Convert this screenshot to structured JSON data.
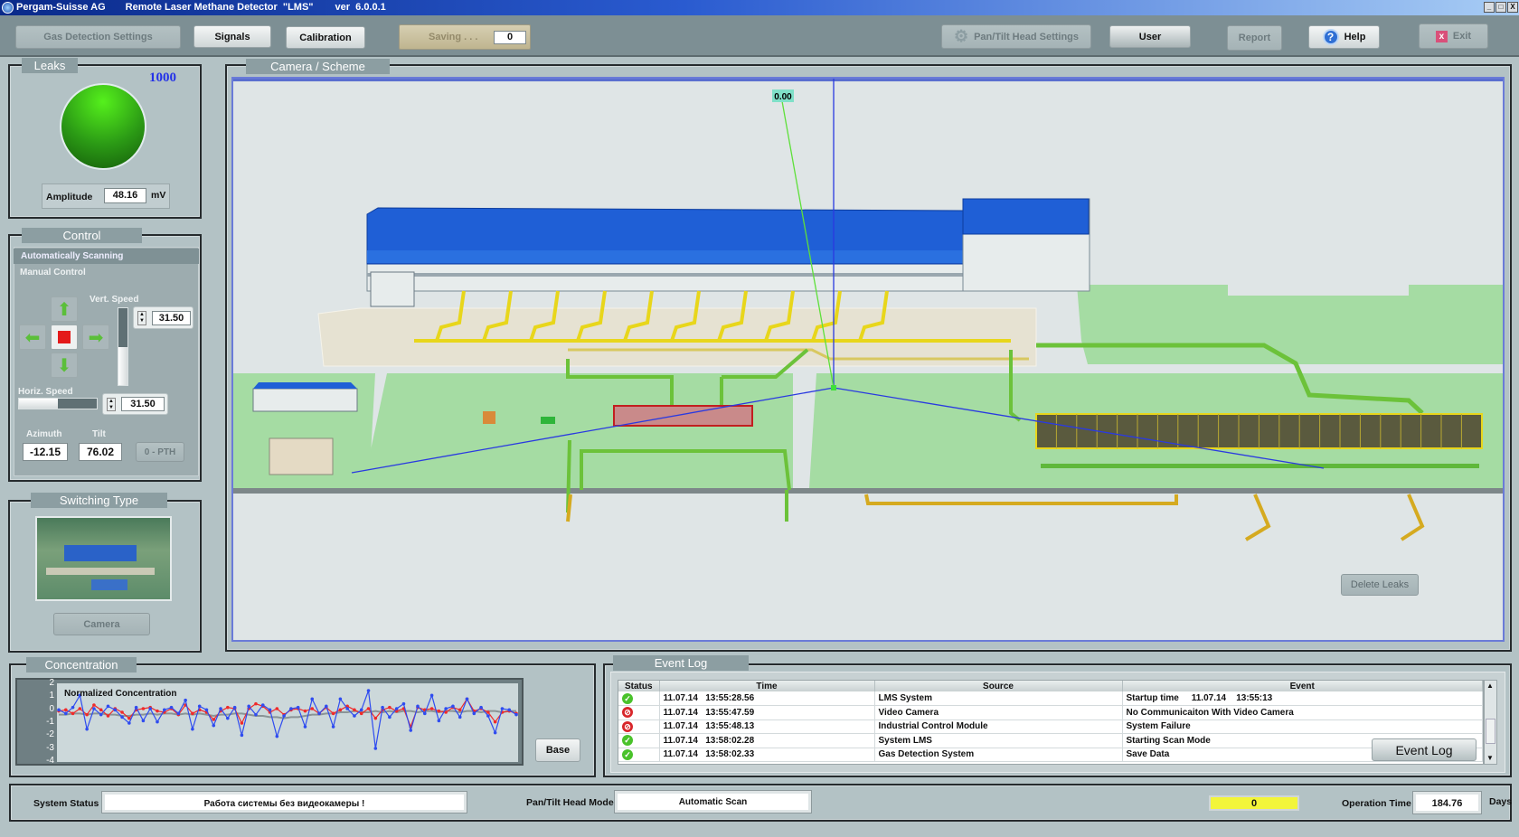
{
  "window": {
    "company": "Pergam-Suisse AG",
    "title": "Remote Laser Methane Detector  \"LMS\"",
    "version": "ver  6.0.0.1",
    "controls": [
      "_",
      "□",
      "X"
    ]
  },
  "toolbar": {
    "gas_detection_settings": "Gas Detection Settings",
    "signals": "Signals",
    "calibration": "Calibration",
    "saving_label": "Saving . . .",
    "saving_value": "0",
    "pan_tilt_settings": "Pan/Tilt Head Settings",
    "user": "User",
    "report": "Report",
    "help": "Help",
    "exit": "Exit"
  },
  "leaks": {
    "title": "Leaks",
    "count": "1000",
    "indicator_color": "#3fbf1a",
    "amplitude_label": "Amplitude",
    "amplitude_value": "48.16",
    "amplitude_unit": "mV"
  },
  "control": {
    "title": "Control",
    "auto_scan": "Automatically Scanning",
    "manual": "Manual Control",
    "vert_speed_label": "Vert. Speed",
    "vert_speed": "31.50",
    "vert_slider_fraction": 0.5,
    "horiz_speed_label": "Horiz. Speed",
    "horiz_speed": "31.50",
    "horiz_slider_fraction": 0.5,
    "azimuth_label": "Azimuth",
    "azimuth": "-12.15",
    "tilt_label": "Tilt",
    "tilt": "76.02",
    "pth_button": "0 - PTH"
  },
  "switching": {
    "title": "Switching Type",
    "camera_button": "Camera"
  },
  "camera": {
    "title": "Camera / Scheme",
    "marker_value": "0.00",
    "delete_leaks": "Delete Leaks"
  },
  "concentration": {
    "title": "Concentration",
    "chart_title": "Normalized Concentration",
    "y_ticks": [
      "2",
      "1",
      "0",
      "-1",
      "-2",
      "-3",
      "-4"
    ],
    "base_button": "Base"
  },
  "chart_data": {
    "type": "line",
    "title": "Normalized Concentration",
    "ylim": [
      -4,
      2
    ],
    "series": [
      {
        "color": "#2f4cf0",
        "values": [
          0.1,
          -0.2,
          0.3,
          1.3,
          -1.5,
          0.2,
          -0.3,
          0.4,
          0.1,
          -0.5,
          -1.0,
          0.3,
          -0.8,
          0.2,
          -0.9,
          0.1,
          0.3,
          -0.2,
          0.9,
          -1.5,
          0.4,
          0.1,
          -1.2,
          0.2,
          -0.6,
          0.3,
          -2.0,
          0.4,
          -0.3,
          0.5,
          0.1,
          -2.1,
          -0.4,
          0.2,
          0.3,
          -1.3,
          1.0,
          -0.2,
          0.4,
          -1.3,
          1.0,
          0.2,
          -0.4,
          0.1,
          1.7,
          -3.1,
          0.3,
          -0.5,
          0.2,
          0.6,
          -1.6,
          0.4,
          -0.2,
          1.3,
          -0.8,
          0.2,
          0.4,
          -0.5,
          1.0,
          -0.2,
          0.3,
          -0.4,
          -1.8,
          0.2,
          0.1,
          -0.3
        ]
      },
      {
        "color": "#f02a2a",
        "values": [
          0.0,
          0.1,
          -0.2,
          0.2,
          -0.3,
          0.5,
          0.1,
          -0.4,
          0.2,
          -0.1,
          -0.6,
          0.1,
          0.2,
          0.3,
          0.0,
          -0.1,
          0.2,
          -0.3,
          0.5,
          -0.2,
          0.1,
          -0.1,
          -0.7,
          0.0,
          0.3,
          0.2,
          -1.0,
          0.2,
          0.6,
          0.4,
          -0.1,
          0.2,
          -0.3,
          0.1,
          0.2,
          0.0,
          0.2,
          -0.2,
          0.3,
          -0.2,
          0.1,
          0.4,
          0.1,
          -0.2,
          0.2,
          -0.6,
          0.1,
          0.3,
          0.0,
          0.2,
          -1.3,
          0.3,
          0.1,
          0.2,
          0.0,
          -0.1,
          0.3,
          0.1,
          1.0,
          0.0,
          0.2,
          -0.1,
          -0.9,
          -0.1,
          0.0,
          -0.2
        ]
      },
      {
        "color": "#8a9496",
        "values": [
          -0.3,
          -0.3,
          -0.2,
          -0.2,
          -0.3,
          -0.2,
          -0.2,
          -0.3,
          -0.3,
          -0.4,
          -0.4,
          -0.3,
          -0.3,
          -0.2,
          -0.3,
          -0.2,
          -0.2,
          -0.3,
          -0.2,
          -0.3,
          -0.2,
          -0.3,
          -0.4,
          -0.3,
          -0.3,
          -0.2,
          -0.2,
          -0.3,
          -0.4,
          -0.4,
          -0.5,
          -0.5,
          -0.6,
          -0.5,
          -0.5,
          -0.4,
          -0.3,
          -0.3,
          -0.2,
          -0.2,
          -0.1,
          -0.1,
          0.0,
          -0.1,
          -0.1,
          0.0,
          -0.1,
          0.0,
          -0.1,
          0.0,
          0.0,
          -0.1,
          0.0,
          0.0,
          -0.1,
          0.0,
          0.0,
          -0.1,
          0.0,
          0.0,
          -0.1,
          0.0,
          0.0,
          -0.1,
          0.0,
          0.0
        ]
      }
    ]
  },
  "event_log": {
    "title": "Event Log",
    "button": "Event Log",
    "columns": [
      "Status",
      "Time",
      "Source",
      "Event"
    ],
    "rows": [
      {
        "status": "ok",
        "time": "11.07.14   13:55:28.56",
        "source": "LMS System",
        "event": "Startup time     11.07.14    13:55:13"
      },
      {
        "status": "error",
        "time": "11.07.14   13:55:47.59",
        "source": "Video Camera",
        "event": "No Communicaiton With Video Camera"
      },
      {
        "status": "error",
        "time": "11.07.14   13:55:48.13",
        "source": "Industrial Control Module",
        "event": "System Failure"
      },
      {
        "status": "ok",
        "time": "11.07.14   13:58:02.28",
        "source": "System LMS",
        "event": "Starting Scan Mode"
      },
      {
        "status": "ok",
        "time": "11.07.14   13:58:02.33",
        "source": "Gas Detection System",
        "event": "Save Data"
      }
    ]
  },
  "statusbar": {
    "system_status_label": "System Status",
    "system_status": "Работа системы без  видеокамеры !",
    "head_mode_label": "Pan/Tilt Head Mode",
    "head_mode": "Automatic Scan",
    "counter": "0",
    "counter_color": "#f2f53a",
    "operation_time_label": "Operation Time",
    "operation_time": "184.76",
    "operation_time_unit": "Days"
  }
}
